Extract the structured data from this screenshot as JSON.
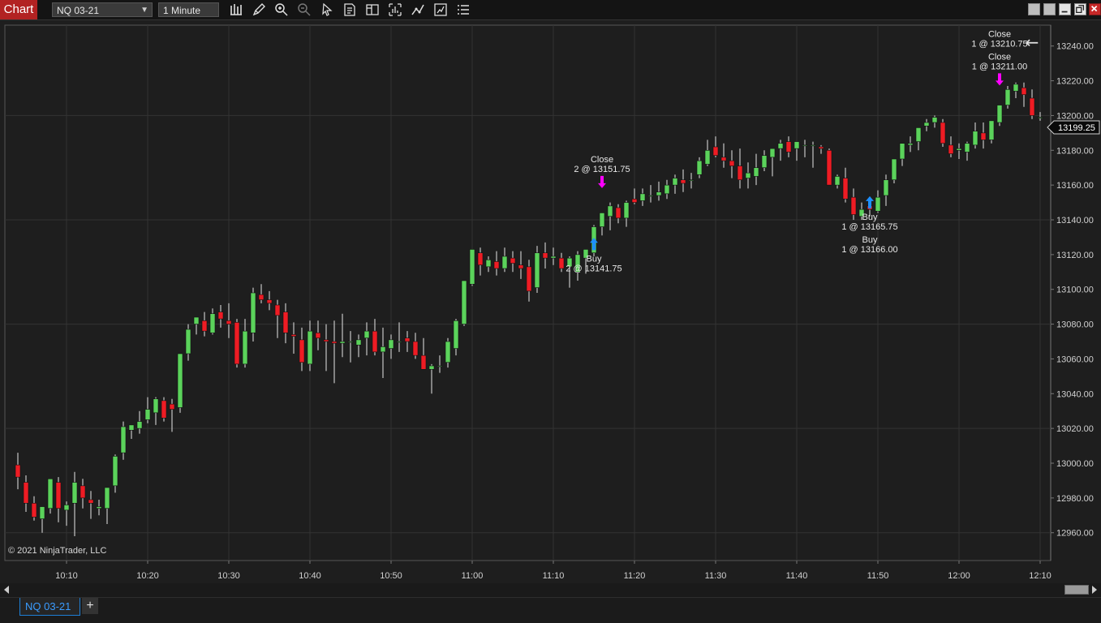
{
  "window": {
    "title": "Chart"
  },
  "toolbar": {
    "instrument": "NQ 03-21",
    "interval": "1 Minute",
    "tools": [
      "bars-type-icon",
      "draw-pencil-icon",
      "zoom-in-icon",
      "zoom-out-icon",
      "pointer-icon",
      "properties-icon",
      "templates-icon",
      "zoom-box-icon",
      "indicators-icon",
      "strategies-icon",
      "menu-list-icon"
    ]
  },
  "chart": {
    "copyright": "© 2021 NinjaTrader, LLC",
    "current_price_label": "13199.25",
    "back_arrow": "←",
    "colors": {
      "up": "#5bd35b",
      "down": "#ee1c24",
      "buy_arrow": "#1e90ff",
      "sell_arrow": "#ff00ff",
      "background": "#1e1e1e"
    },
    "markers": [
      {
        "label": "Buy",
        "detail": "2 @ 13141.75",
        "kind": "buy",
        "time": "11:15",
        "price": 13141.75
      },
      {
        "label": "Close",
        "detail": "2 @ 13151.75",
        "kind": "sell",
        "time": "11:16",
        "price": 13151.75
      },
      {
        "label": "Buy",
        "detail": "1 @ 13165.75",
        "kind": "buy",
        "time": "11:49",
        "price": 13165.75
      },
      {
        "label": "Buy",
        "detail": "1 @ 13166.00",
        "kind": "buy",
        "time": "11:49",
        "price": 13166.0
      },
      {
        "label": "Close",
        "detail": "1 @ 13210.75",
        "kind": "sell",
        "time": "12:05",
        "price": 13210.75
      },
      {
        "label": "Close",
        "detail": "1 @ 13211.00",
        "kind": "sell",
        "time": "12:05",
        "price": 13211.0
      }
    ]
  },
  "chart_data": {
    "type": "candlestick",
    "x_labels": [
      "10:10",
      "10:20",
      "10:30",
      "10:40",
      "10:50",
      "11:00",
      "11:10",
      "11:20",
      "11:30",
      "11:40",
      "11:50",
      "12:00",
      "12:10"
    ],
    "y_ticks": [
      "12960.00",
      "12980.00",
      "13000.00",
      "13020.00",
      "13040.00",
      "13060.00",
      "13080.00",
      "13100.00",
      "13120.00",
      "13140.00",
      "13160.00",
      "13180.00",
      "13200.00",
      "13220.00",
      "13240.00"
    ],
    "ylim": [
      12944,
      13252
    ],
    "first_bar": "10:04",
    "bar_minutes": 1,
    "grid": true,
    "bars": [
      [
        12999,
        13006,
        12985,
        12992
      ],
      [
        12989,
        12993,
        12972,
        12977
      ],
      [
        12977,
        12981,
        12967,
        12969
      ],
      [
        12968,
        12974,
        12960,
        12975
      ],
      [
        12974,
        12991,
        12971,
        12991
      ],
      [
        12989,
        12992,
        12966,
        12974
      ],
      [
        12973,
        12978,
        12964,
        12976
      ],
      [
        12977,
        12995,
        12958,
        12989
      ],
      [
        12987,
        12991,
        12974,
        12980
      ],
      [
        12979,
        12984,
        12968,
        12977
      ],
      [
        12974,
        12979,
        12970,
        12975
      ],
      [
        12974,
        12986,
        12965,
        12986
      ],
      [
        12987,
        13005,
        12983,
        13004
      ],
      [
        13006,
        13024,
        13002,
        13021
      ],
      [
        13019,
        13021,
        13014,
        13022
      ],
      [
        13020,
        13030,
        13017,
        13024
      ],
      [
        13025,
        13038,
        13023,
        13031
      ],
      [
        13029,
        13038,
        13022,
        13037
      ],
      [
        13036,
        13038,
        13024,
        13026
      ],
      [
        13034,
        13037,
        13018,
        13031
      ],
      [
        13032,
        13062,
        13029,
        13063
      ],
      [
        13063,
        13080,
        13059,
        13077
      ],
      [
        13080,
        13084,
        13074,
        13084
      ],
      [
        13082,
        13087,
        13073,
        13076
      ],
      [
        13075,
        13089,
        13074,
        13086
      ],
      [
        13087,
        13091,
        13078,
        13083
      ],
      [
        13082,
        13092,
        13072,
        13080
      ],
      [
        13081,
        13083,
        13055,
        13057
      ],
      [
        13057,
        13083,
        13055,
        13076
      ],
      [
        13075,
        13101,
        13070,
        13098
      ],
      [
        13097,
        13103,
        13092,
        13094
      ],
      [
        13094,
        13099,
        13088,
        13092
      ],
      [
        13091,
        13094,
        13072,
        13085
      ],
      [
        13087,
        13092,
        13069,
        13075
      ],
      [
        13074,
        13081,
        13063,
        13073
      ],
      [
        13071,
        13078,
        13053,
        13058
      ],
      [
        13057,
        13082,
        13053,
        13076
      ],
      [
        13075,
        13082,
        13065,
        13072
      ],
      [
        13071,
        13080,
        13053,
        13070
      ],
      [
        13070,
        13082,
        13046,
        13069
      ],
      [
        13069,
        13086,
        13061,
        13070
      ],
      [
        13070,
        13076,
        13058,
        13070
      ],
      [
        13068,
        13074,
        13061,
        13071
      ],
      [
        13072,
        13081,
        13062,
        13076
      ],
      [
        13076,
        13083,
        13062,
        13064
      ],
      [
        13064,
        13078,
        13049,
        13067
      ],
      [
        13066,
        13074,
        13060,
        13071
      ],
      [
        13070,
        13081,
        13064,
        13070
      ],
      [
        13072,
        13076,
        13064,
        13070
      ],
      [
        13070,
        13075,
        13060,
        13062
      ],
      [
        13062,
        13072,
        13055,
        13054
      ],
      [
        13054,
        13057,
        13040,
        13056
      ],
      [
        13056,
        13062,
        13052,
        13056
      ],
      [
        13058,
        13072,
        13055,
        13070
      ],
      [
        13066,
        13083,
        13062,
        13082
      ],
      [
        13080,
        13102,
        13079,
        13105
      ],
      [
        13103,
        13118,
        13102,
        13123
      ],
      [
        13121,
        13124,
        13108,
        13114
      ],
      [
        13113,
        13119,
        13110,
        13117
      ],
      [
        13116,
        13122,
        13108,
        13112
      ],
      [
        13112,
        13124,
        13110,
        13119
      ],
      [
        13118,
        13122,
        13110,
        13115
      ],
      [
        13114,
        13122,
        13106,
        13112
      ],
      [
        13113,
        13117,
        13093,
        13099
      ],
      [
        13101,
        13125,
        13098,
        13121
      ],
      [
        13121,
        13127,
        13112,
        13118
      ],
      [
        13118,
        13124,
        13114,
        13119
      ],
      [
        13118,
        13121,
        13110,
        13112
      ],
      [
        13113,
        13119,
        13101,
        13118
      ],
      [
        13110,
        13122,
        13105,
        13120
      ],
      [
        13118,
        13122,
        13109,
        13123
      ],
      [
        13121,
        13137,
        13119,
        13136
      ],
      [
        13136,
        13142,
        13131,
        13144
      ],
      [
        13142,
        13150,
        13134,
        13148
      ],
      [
        13147,
        13149,
        13138,
        13141
      ],
      [
        13141,
        13151,
        13136,
        13150
      ],
      [
        13152,
        13158,
        13149,
        13150
      ],
      [
        13151,
        13158,
        13148,
        13155
      ],
      [
        13154,
        13160,
        13150,
        13154
      ],
      [
        13154,
        13162,
        13151,
        13156
      ],
      [
        13155,
        13163,
        13152,
        13160
      ],
      [
        13160,
        13166,
        13155,
        13164
      ],
      [
        13163,
        13169,
        13156,
        13161
      ],
      [
        13163,
        13167,
        13158,
        13163
      ],
      [
        13166,
        13176,
        13164,
        13174
      ],
      [
        13172,
        13186,
        13171,
        13180
      ],
      [
        13182,
        13188,
        13176,
        13177
      ],
      [
        13176,
        13184,
        13170,
        13174
      ],
      [
        13174,
        13180,
        13164,
        13171
      ],
      [
        13171,
        13181,
        13158,
        13163
      ],
      [
        13164,
        13173,
        13158,
        13167
      ],
      [
        13165,
        13178,
        13160,
        13170
      ],
      [
        13170,
        13180,
        13168,
        13177
      ],
      [
        13176,
        13181,
        13165,
        13181
      ],
      [
        13181,
        13186,
        13174,
        13184
      ],
      [
        13185,
        13188,
        13176,
        13179
      ],
      [
        13181,
        13184,
        13174,
        13185
      ],
      [
        13183,
        13186,
        13176,
        13183
      ],
      [
        13183,
        13185,
        13170,
        13183
      ],
      [
        13182,
        13183,
        13178,
        13181
      ],
      [
        13180,
        13181,
        13162,
        13160
      ],
      [
        13160,
        13166,
        13158,
        13165
      ],
      [
        13164,
        13170,
        13150,
        13152
      ],
      [
        13153,
        13158,
        13140,
        13143
      ],
      [
        13142,
        13150,
        13140,
        13146
      ],
      [
        13148,
        13152,
        13142,
        13146
      ],
      [
        13145,
        13157,
        13144,
        13153
      ],
      [
        13154,
        13166,
        13148,
        13163
      ],
      [
        13163,
        13175,
        13161,
        13175
      ],
      [
        13175,
        13183,
        13171,
        13184
      ],
      [
        13183,
        13188,
        13179,
        13184
      ],
      [
        13185,
        13192,
        13180,
        13193
      ],
      [
        13194,
        13198,
        13191,
        13196
      ],
      [
        13196,
        13200,
        13193,
        13199
      ],
      [
        13196,
        13198,
        13182,
        13184
      ],
      [
        13183,
        13188,
        13176,
        13178
      ],
      [
        13180,
        13184,
        13175,
        13181
      ],
      [
        13179,
        13185,
        13174,
        13184
      ],
      [
        13183,
        13196,
        13181,
        13191
      ],
      [
        13190,
        13196,
        13181,
        13186
      ],
      [
        13186,
        13196,
        13184,
        13197
      ],
      [
        13196,
        13206,
        13194,
        13206
      ],
      [
        13206,
        13217,
        13204,
        13215
      ],
      [
        13214,
        13219,
        13210,
        13218
      ],
      [
        13216,
        13219,
        13205,
        13212
      ],
      [
        13210,
        13215,
        13198,
        13200
      ],
      [
        13199,
        13202,
        13197,
        13199
      ]
    ]
  }
}
